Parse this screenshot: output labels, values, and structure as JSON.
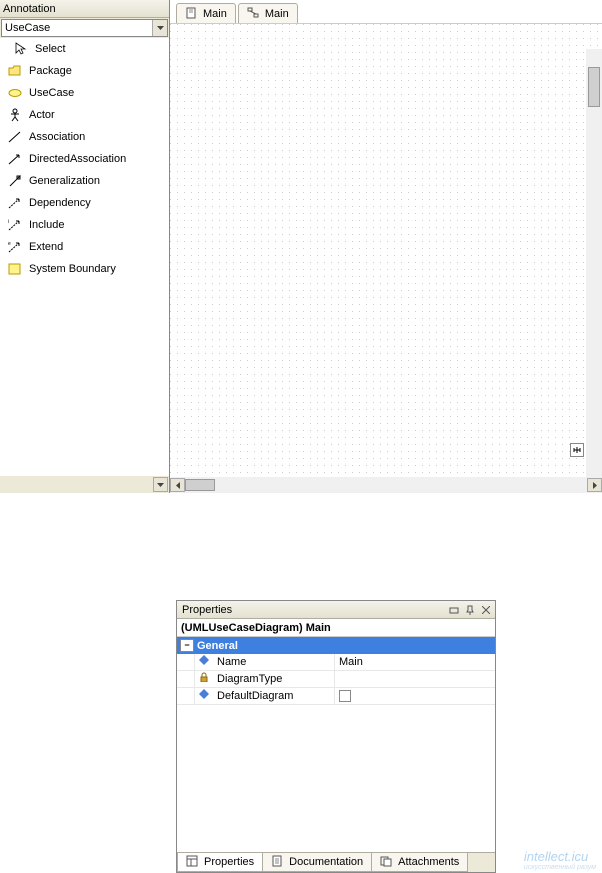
{
  "palette": {
    "header": "Annotation",
    "dropdown": "UseCase",
    "items": [
      {
        "label": "Select",
        "icon": "cursor",
        "sel": true
      },
      {
        "label": "Package",
        "icon": "folder"
      },
      {
        "label": "UseCase",
        "icon": "oval"
      },
      {
        "label": "Actor",
        "icon": "actor"
      },
      {
        "label": "Association",
        "icon": "assoc"
      },
      {
        "label": "DirectedAssociation",
        "icon": "dassoc"
      },
      {
        "label": "Generalization",
        "icon": "gen"
      },
      {
        "label": "Dependency",
        "icon": "dep"
      },
      {
        "label": "Include",
        "icon": "incl"
      },
      {
        "label": "Extend",
        "icon": "ext"
      },
      {
        "label": "System Boundary",
        "icon": "rect"
      }
    ]
  },
  "diagram_tabs": [
    {
      "label": "Main",
      "icon": "page"
    },
    {
      "label": "Main",
      "icon": "diag"
    }
  ],
  "properties": {
    "panel_title": "Properties",
    "object_label": "(UMLUseCaseDiagram) Main",
    "category": "General",
    "rows": [
      {
        "name": "Name",
        "value": "Main",
        "icon": "blue-diamond"
      },
      {
        "name": "DiagramType",
        "value": "",
        "icon": "lock"
      },
      {
        "name": "DefaultDiagram",
        "value": "",
        "icon": "blue-diamond",
        "checkbox": true
      }
    ],
    "bottom_tabs": [
      {
        "label": "Properties",
        "icon": "props"
      },
      {
        "label": "Documentation",
        "icon": "doc"
      },
      {
        "label": "Attachments",
        "icon": "attach"
      }
    ]
  },
  "watermark": {
    "main": "intellect.icu",
    "sub": "искусственный разум"
  }
}
